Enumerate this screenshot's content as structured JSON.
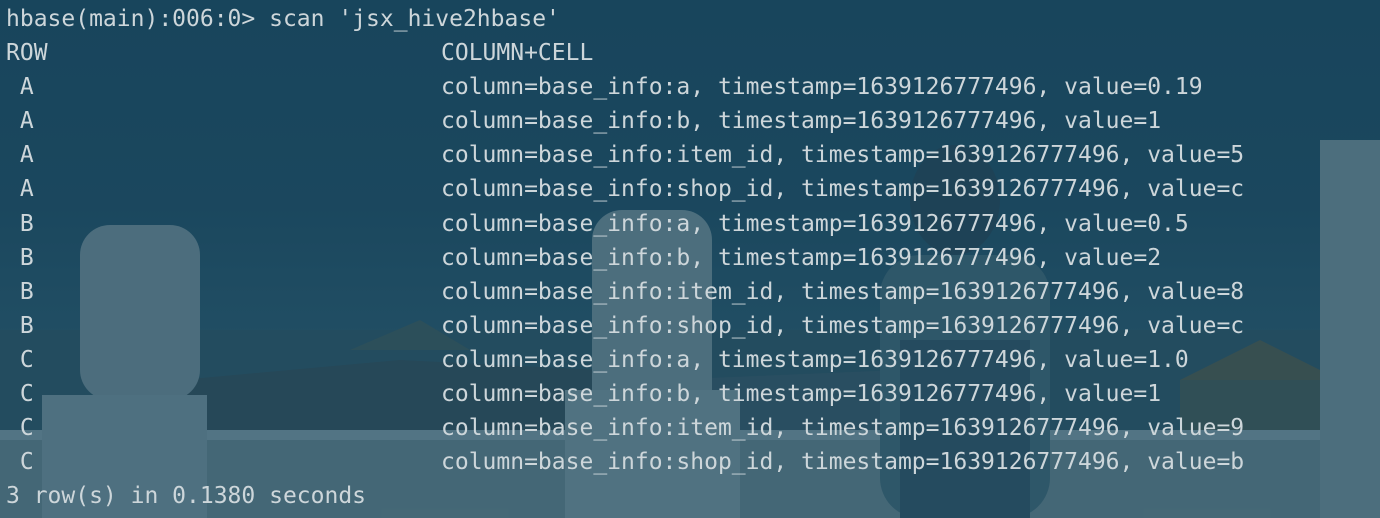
{
  "terminal": {
    "prompt": "hbase(main):006:0> scan 'jsx_hive2hbase'",
    "header": {
      "row": "ROW",
      "column_cell": "COLUMN+CELL"
    },
    "rows": [
      {
        "key": " A",
        "cell": "column=base_info:a, timestamp=1639126777496, value=0.19"
      },
      {
        "key": " A",
        "cell": "column=base_info:b, timestamp=1639126777496, value=1"
      },
      {
        "key": " A",
        "cell": "column=base_info:item_id, timestamp=1639126777496, value=5"
      },
      {
        "key": " A",
        "cell": "column=base_info:shop_id, timestamp=1639126777496, value=c"
      },
      {
        "key": " B",
        "cell": "column=base_info:a, timestamp=1639126777496, value=0.5"
      },
      {
        "key": " B",
        "cell": "column=base_info:b, timestamp=1639126777496, value=2"
      },
      {
        "key": " B",
        "cell": "column=base_info:item_id, timestamp=1639126777496, value=8"
      },
      {
        "key": " B",
        "cell": "column=base_info:shop_id, timestamp=1639126777496, value=c"
      },
      {
        "key": " C",
        "cell": "column=base_info:a, timestamp=1639126777496, value=1.0"
      },
      {
        "key": " C",
        "cell": "column=base_info:b, timestamp=1639126777496, value=1"
      },
      {
        "key": " C",
        "cell": "column=base_info:item_id, timestamp=1639126777496, value=9"
      },
      {
        "key": " C",
        "cell": "column=base_info:shop_id, timestamp=1639126777496, value=b"
      }
    ],
    "summary": "3 row(s) in 0.1380 seconds"
  },
  "colors": {
    "text": "#cdd6da",
    "background": "#1f4e66"
  }
}
